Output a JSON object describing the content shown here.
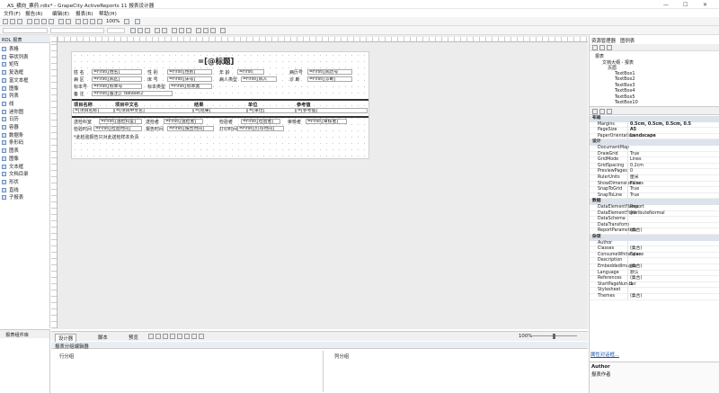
{
  "window": {
    "title": "AS_横向_票药.rdlx* - GrapeCity ActiveReports 11 报表设计器",
    "controls": [
      "—",
      "☐",
      "✕"
    ]
  },
  "menu": [
    "文件(F)",
    "报告(R)",
    "编辑(E)",
    "报表(R)",
    "帮助(H)"
  ],
  "toolbar": {
    "zoom": "100%"
  },
  "left_panel": {
    "header": "RDL 报表",
    "tools": [
      "表格",
      "带状列表",
      "矩阵",
      "复选框",
      "富文本框",
      "图像",
      "列表",
      "线",
      "迷你图",
      "日历",
      "容器",
      "数据条",
      "条形码",
      "图表",
      "图像",
      "文本框",
      "文档目录",
      "形状",
      "直线",
      "子报表"
    ],
    "footer": "报表组件库"
  },
  "report": {
    "title": "=[@标题]",
    "fields": [
      {
        "label": "姓    名",
        "value": "=First([姓名]"
      },
      {
        "label": "性    别",
        "value": "=First([性别]"
      },
      {
        "label": "年    龄",
        "value": "=First("
      },
      {
        "label": "病历号",
        "value": "=First([病历号"
      },
      {
        "label": "病    区",
        "value": "=First([病区]"
      },
      {
        "label": "床    号",
        "value": "=First([床号]"
      },
      {
        "label": "病人类型",
        "value": "=First([病人"
      },
      {
        "label": "诊    断",
        "value": "=First([诊断]"
      },
      {
        "label": "标本号",
        "value": "=First([标本号"
      },
      {
        "label": "标本类型",
        "value": "=First([标本类"
      },
      {
        "label": "备    注",
        "value": "=First([备注])",
        "extra": "'dataset2'"
      }
    ],
    "table_headers": [
      "项目名称",
      "项目中文名",
      "结果",
      "单位",
      "参考值"
    ],
    "table_row": [
      "=[项目名称]",
      "=[项目中文名]",
      "=[结果]",
      "=[单位]",
      "=[参考值]"
    ],
    "footer_fields": [
      {
        "label": "送检科室",
        "value": "=First([送检科室]"
      },
      {
        "label": "送检者",
        "value": "=First([送检者]"
      },
      {
        "label": "检验者",
        "value": "=First([检验者]"
      },
      {
        "label": "审核者",
        "value": "=First([审核者]"
      },
      {
        "label": "检验时间",
        "value": "=First([检验时间]"
      },
      {
        "label": "报告时间",
        "value": "=First([报告时间]"
      },
      {
        "label": "打印时间",
        "value": "=First([打印时间]"
      }
    ],
    "note": "*此检验报告只对此送检样本负责"
  },
  "bottom_tabs": [
    "设计器",
    "脚本",
    "预览"
  ],
  "zoom_status": "100%",
  "grouping": {
    "title": "报表分组编辑器",
    "row_group": "行分组",
    "col_group": "列分组"
  },
  "right_panel": {
    "tabs": [
      "资源管理器",
      "图例表"
    ],
    "tree": [
      "报表",
      "文档大纲 - 报表",
      "页眉",
      "TextBox1",
      "TextBox2",
      "TextBox3",
      "TextBox4",
      "TextBox5",
      "TextBox10"
    ],
    "categories": [
      {
        "name": "布局",
        "props": [
          [
            "Margins",
            "0.5cm, 0.5cm, 0.5cm, 0.5"
          ],
          [
            "PageSize",
            "A5"
          ],
          [
            "PaperOrientation",
            "Landscape"
          ]
        ]
      },
      {
        "name": "设计",
        "props": [
          [
            "DocumentMap",
            ""
          ],
          [
            "DrawGrid",
            "True"
          ],
          [
            "GridMode",
            "Lines"
          ],
          [
            "GridSpacing",
            "0.2cm"
          ],
          [
            "PreviewPages",
            "0"
          ],
          [
            "RulerUnits",
            "厘米"
          ],
          [
            "ShowDimensionLines",
            "False"
          ],
          [
            "SnapToGrid",
            "True"
          ],
          [
            "SnapToLine",
            "True"
          ]
        ]
      },
      {
        "name": "数据",
        "props": [
          [
            "DataElementName",
            "Report"
          ],
          [
            "DataElementStyle",
            "AttributeNormal"
          ],
          [
            "DataSchema",
            ""
          ],
          [
            "DataTransform",
            ""
          ],
          [
            "ReportParameters",
            "(集合)"
          ]
        ]
      },
      {
        "name": "杂项",
        "props": [
          [
            "Author",
            ""
          ],
          [
            "Classes",
            "(集合)"
          ],
          [
            "ConsumeWhiteSpace",
            "False"
          ],
          [
            "Description",
            ""
          ],
          [
            "EmbeddedImages",
            "(集合)"
          ],
          [
            "Language",
            "默认"
          ],
          [
            "References",
            "(集合)"
          ],
          [
            "StartPageNumber",
            "1"
          ],
          [
            "Stylesheet",
            ""
          ],
          [
            "Themes",
            "(集合)"
          ]
        ]
      }
    ],
    "link": "属性对话框...",
    "desc_title": "Author",
    "desc_text": "报表作者"
  }
}
